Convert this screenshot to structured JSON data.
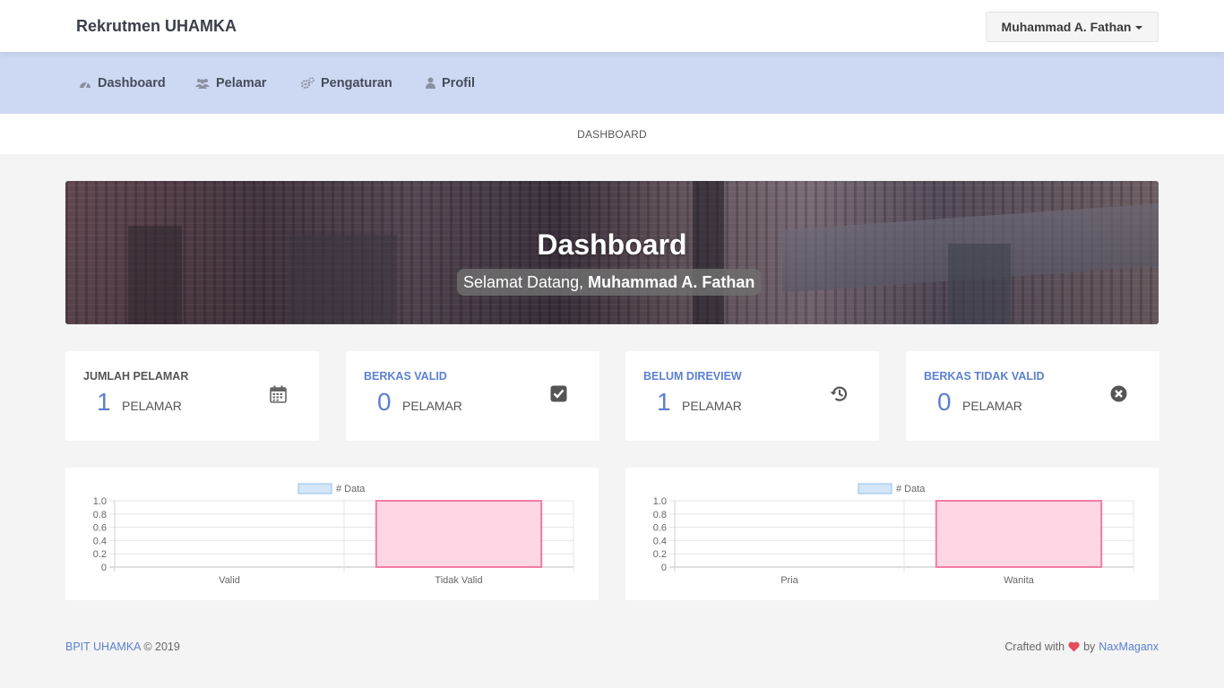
{
  "header": {
    "brand": "Rekrutmen UHAMKA",
    "user_name": "Muhammad A. Fathan"
  },
  "nav": [
    {
      "label": "Dashboard",
      "icon": "dashboard-icon"
    },
    {
      "label": "Pelamar",
      "icon": "users-icon"
    },
    {
      "label": "Pengaturan",
      "icon": "cogs-icon"
    },
    {
      "label": "Profil",
      "icon": "user-icon"
    }
  ],
  "breadcrumb": "DASHBOARD",
  "hero": {
    "title": "Dashboard",
    "greeting": "Selamat Datang,",
    "user": "Muhammad A. Fathan"
  },
  "stats": [
    {
      "label": "JUMLAH PELAMAR",
      "value": "1",
      "unit": "PELAMAR",
      "icon": "calendar-icon",
      "label_color": "#555555"
    },
    {
      "label": "BERKAS VALID",
      "value": "0",
      "unit": "PELAMAR",
      "icon": "check-square-icon",
      "label_color": "#5c80d1"
    },
    {
      "label": "BELUM DIREVIEW",
      "value": "1",
      "unit": "PELAMAR",
      "icon": "history-icon",
      "label_color": "#5c80d1"
    },
    {
      "label": "BERKAS TIDAK VALID",
      "value": "0",
      "unit": "PELAMAR",
      "icon": "times-circle-icon",
      "label_color": "#5c80d1"
    }
  ],
  "chart_data": [
    {
      "type": "bar",
      "categories": [
        "Valid",
        "Tidak Valid"
      ],
      "series": [
        {
          "name": "# Data",
          "values": [
            0,
            1
          ]
        }
      ],
      "ylim": [
        0,
        1
      ],
      "yticks": [
        "1.0",
        "0.8",
        "0.6",
        "0.4",
        "0.2",
        "0"
      ],
      "legend": "top-center",
      "grid": true,
      "bar_fill": "#ffd6e3",
      "bar_stroke": "#f27ca6",
      "legend_fill": "#d4e6f8",
      "legend_stroke": "#8ec0ec"
    },
    {
      "type": "bar",
      "categories": [
        "Pria",
        "Wanita"
      ],
      "series": [
        {
          "name": "# Data",
          "values": [
            0,
            1
          ]
        }
      ],
      "ylim": [
        0,
        1
      ],
      "yticks": [
        "1.0",
        "0.8",
        "0.6",
        "0.4",
        "0.2",
        "0"
      ],
      "legend": "top-center",
      "grid": true,
      "bar_fill": "#ffd6e3",
      "bar_stroke": "#f27ca6",
      "legend_fill": "#d4e6f8",
      "legend_stroke": "#8ec0ec"
    }
  ],
  "footer": {
    "org": "BPIT UHAMKA",
    "year": "© 2019",
    "crafted": "Crafted with",
    "by": "by",
    "author": "NaxMaganx",
    "heart_color": "#e74c5a"
  },
  "colors": {
    "accent": "#5c80d1",
    "nav_bg": "#cdd9f3"
  }
}
